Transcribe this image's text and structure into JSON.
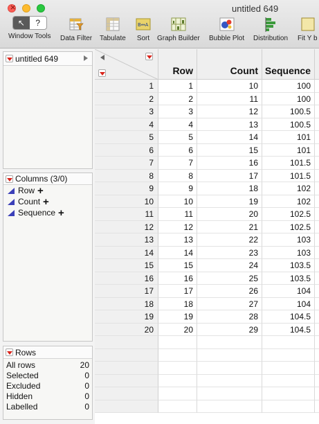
{
  "window": {
    "title": "untitled 649"
  },
  "toolbar": {
    "tools": [
      {
        "label": "Window Tools",
        "icon": "arrow-help-segment"
      },
      {
        "label": "Data Filter",
        "icon": "data-filter-icon"
      },
      {
        "label": "Tabulate",
        "icon": "tabulate-icon"
      },
      {
        "label": "Sort",
        "icon": "sort-icon"
      },
      {
        "label": "Graph Builder",
        "icon": "graph-builder-icon"
      },
      {
        "label": "Bubble Plot",
        "icon": "bubble-plot-icon"
      },
      {
        "label": "Distribution",
        "icon": "distribution-icon"
      },
      {
        "label": "Fit Y b",
        "icon": "fit-y-by-x-icon"
      }
    ],
    "segment": {
      "pointer": "↖",
      "help": "?"
    }
  },
  "table_panel": {
    "name": "untitled 649"
  },
  "columns_panel": {
    "title": "Columns (3/0)",
    "items": [
      "Row",
      "Count",
      "Sequence"
    ]
  },
  "rows_panel": {
    "title": "Rows",
    "stats": [
      {
        "label": "All rows",
        "value": "20"
      },
      {
        "label": "Selected",
        "value": "0"
      },
      {
        "label": "Excluded",
        "value": "0"
      },
      {
        "label": "Hidden",
        "value": "0"
      },
      {
        "label": "Labelled",
        "value": "0"
      }
    ]
  },
  "table": {
    "headers": [
      "Row",
      "Count",
      "Sequence"
    ],
    "rows": [
      [
        "1",
        "1",
        "10",
        "100"
      ],
      [
        "2",
        "2",
        "11",
        "100"
      ],
      [
        "3",
        "3",
        "12",
        "100.5"
      ],
      [
        "4",
        "4",
        "13",
        "100.5"
      ],
      [
        "5",
        "5",
        "14",
        "101"
      ],
      [
        "6",
        "6",
        "15",
        "101"
      ],
      [
        "7",
        "7",
        "16",
        "101.5"
      ],
      [
        "8",
        "8",
        "17",
        "101.5"
      ],
      [
        "9",
        "9",
        "18",
        "102"
      ],
      [
        "10",
        "10",
        "19",
        "102"
      ],
      [
        "11",
        "11",
        "20",
        "102.5"
      ],
      [
        "12",
        "12",
        "21",
        "102.5"
      ],
      [
        "13",
        "13",
        "22",
        "103"
      ],
      [
        "14",
        "14",
        "23",
        "103"
      ],
      [
        "15",
        "15",
        "24",
        "103.5"
      ],
      [
        "16",
        "16",
        "25",
        "103.5"
      ],
      [
        "17",
        "17",
        "26",
        "104"
      ],
      [
        "18",
        "18",
        "27",
        "104"
      ],
      [
        "19",
        "19",
        "28",
        "104.5"
      ],
      [
        "20",
        "20",
        "29",
        "104.5"
      ]
    ],
    "empty_rows": 6
  },
  "colors": {
    "accent_red": "#d9241b",
    "column_icon": "#3b3fb8"
  }
}
